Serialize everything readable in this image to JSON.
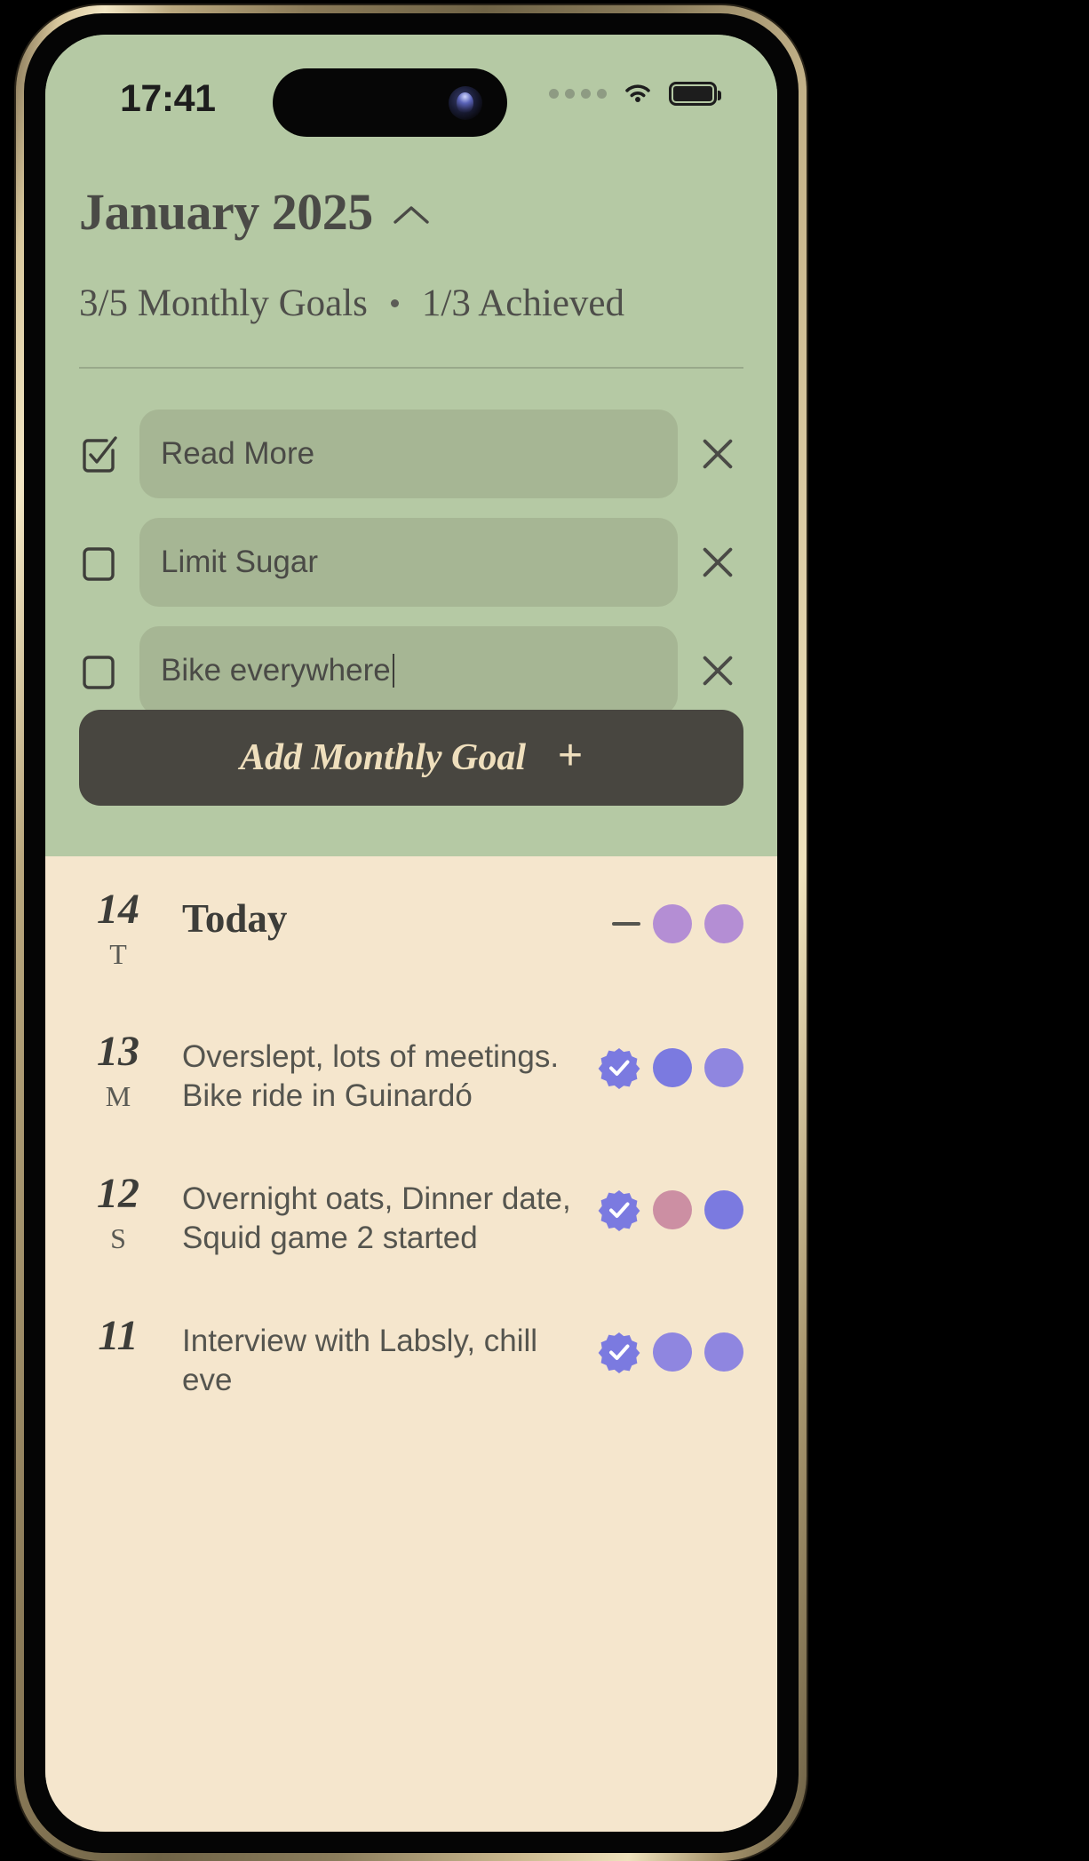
{
  "status_bar": {
    "time": "17:41",
    "signal_icon": "signal-dots-icon",
    "wifi_icon": "wifi-icon",
    "battery_icon": "battery-full-icon"
  },
  "goals_panel": {
    "background_color": "#b5c9a4",
    "month_title": "January 2025",
    "collapse_icon": "chevron-up-icon",
    "summary_left": "3/5 Monthly Goals",
    "summary_separator": "•",
    "summary_right": "1/3 Achieved",
    "goals": [
      {
        "label": "Read More",
        "checked": true,
        "delete_icon": "close-icon"
      },
      {
        "label": "Limit Sugar",
        "checked": false,
        "delete_icon": "close-icon"
      },
      {
        "label": "Bike everywhere",
        "checked": false,
        "delete_icon": "close-icon",
        "editing": true
      }
    ],
    "add_button": {
      "label": "Add Monthly Goal",
      "plus": "+",
      "bg_color": "#484640",
      "text_color": "#efdfbd"
    }
  },
  "journal": {
    "background_color": "#f5e6cd",
    "entries": [
      {
        "day": "14",
        "weekday": "T",
        "title": "Today",
        "text": "",
        "markers": [
          "dash",
          "#b48ed4",
          "#b48ed4"
        ]
      },
      {
        "day": "13",
        "weekday": "M",
        "title": "",
        "text": "Overslept, lots of meetings. Bike ride in Guinardó",
        "markers": [
          "badge",
          "#7b7ae0",
          "#8f86e0"
        ]
      },
      {
        "day": "12",
        "weekday": "S",
        "title": "",
        "text": "Overnight oats, Dinner date, Squid game 2 started",
        "markers": [
          "badge",
          "#cc8fa3",
          "#7b7ae0"
        ]
      },
      {
        "day": "11",
        "weekday": "",
        "title": "",
        "text": "Interview with Labsly, chill eve",
        "markers": [
          "badge",
          "#8f86e0",
          "#8f86e0"
        ]
      }
    ]
  }
}
